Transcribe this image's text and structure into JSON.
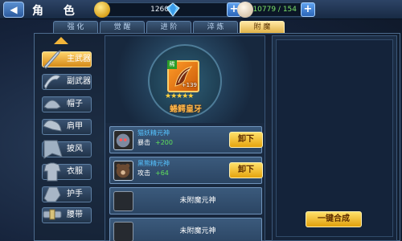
{
  "header": {
    "back_icon": "back-arrow-icon",
    "title": "角 色"
  },
  "resources": {
    "gold": "1260万",
    "diamond_value": "",
    "stamina": "10779 / 154"
  },
  "tabs": [
    {
      "label": "强 化",
      "active": false
    },
    {
      "label": "觉 醒",
      "active": false
    },
    {
      "label": "进 阶",
      "active": false
    },
    {
      "label": "淬 炼",
      "active": false
    },
    {
      "label": "附 魔",
      "active": true
    }
  ],
  "sidebar": {
    "items": [
      {
        "label": "主武器",
        "icon": "main-weapon-icon",
        "active": true
      },
      {
        "label": "副武器",
        "icon": "sub-weapon-icon",
        "active": false
      },
      {
        "label": "帽子",
        "icon": "hat-icon",
        "active": false
      },
      {
        "label": "肩甲",
        "icon": "shoulder-armor-icon",
        "active": false
      },
      {
        "label": "披风",
        "icon": "cape-icon",
        "active": false
      },
      {
        "label": "衣服",
        "icon": "clothes-icon",
        "active": false
      },
      {
        "label": "护手",
        "icon": "gauntlet-icon",
        "active": false
      },
      {
        "label": "腰带",
        "icon": "belt-icon",
        "active": false
      }
    ]
  },
  "item": {
    "tag": "稀",
    "level": "+139",
    "stars": "★★★★★",
    "name": "蜷鳄皇牙"
  },
  "slots": [
    {
      "name": "猫妖精元神",
      "attr": "暴击",
      "value": "+200",
      "button": "卸下",
      "empty": false
    },
    {
      "name": "黑熊精元神",
      "attr": "攻击",
      "value": "+64",
      "button": "卸下",
      "empty": false
    },
    {
      "empty": true,
      "empty_label": "未附魔元神"
    },
    {
      "empty": true,
      "empty_label": "未附魔元神"
    }
  ],
  "merge_button": "一键合成",
  "colors": {
    "accent_gold": "#e5a40e",
    "value_green": "#5fe05a",
    "name_blue": "#55c3ff",
    "item_orange": "#ffb84a"
  }
}
